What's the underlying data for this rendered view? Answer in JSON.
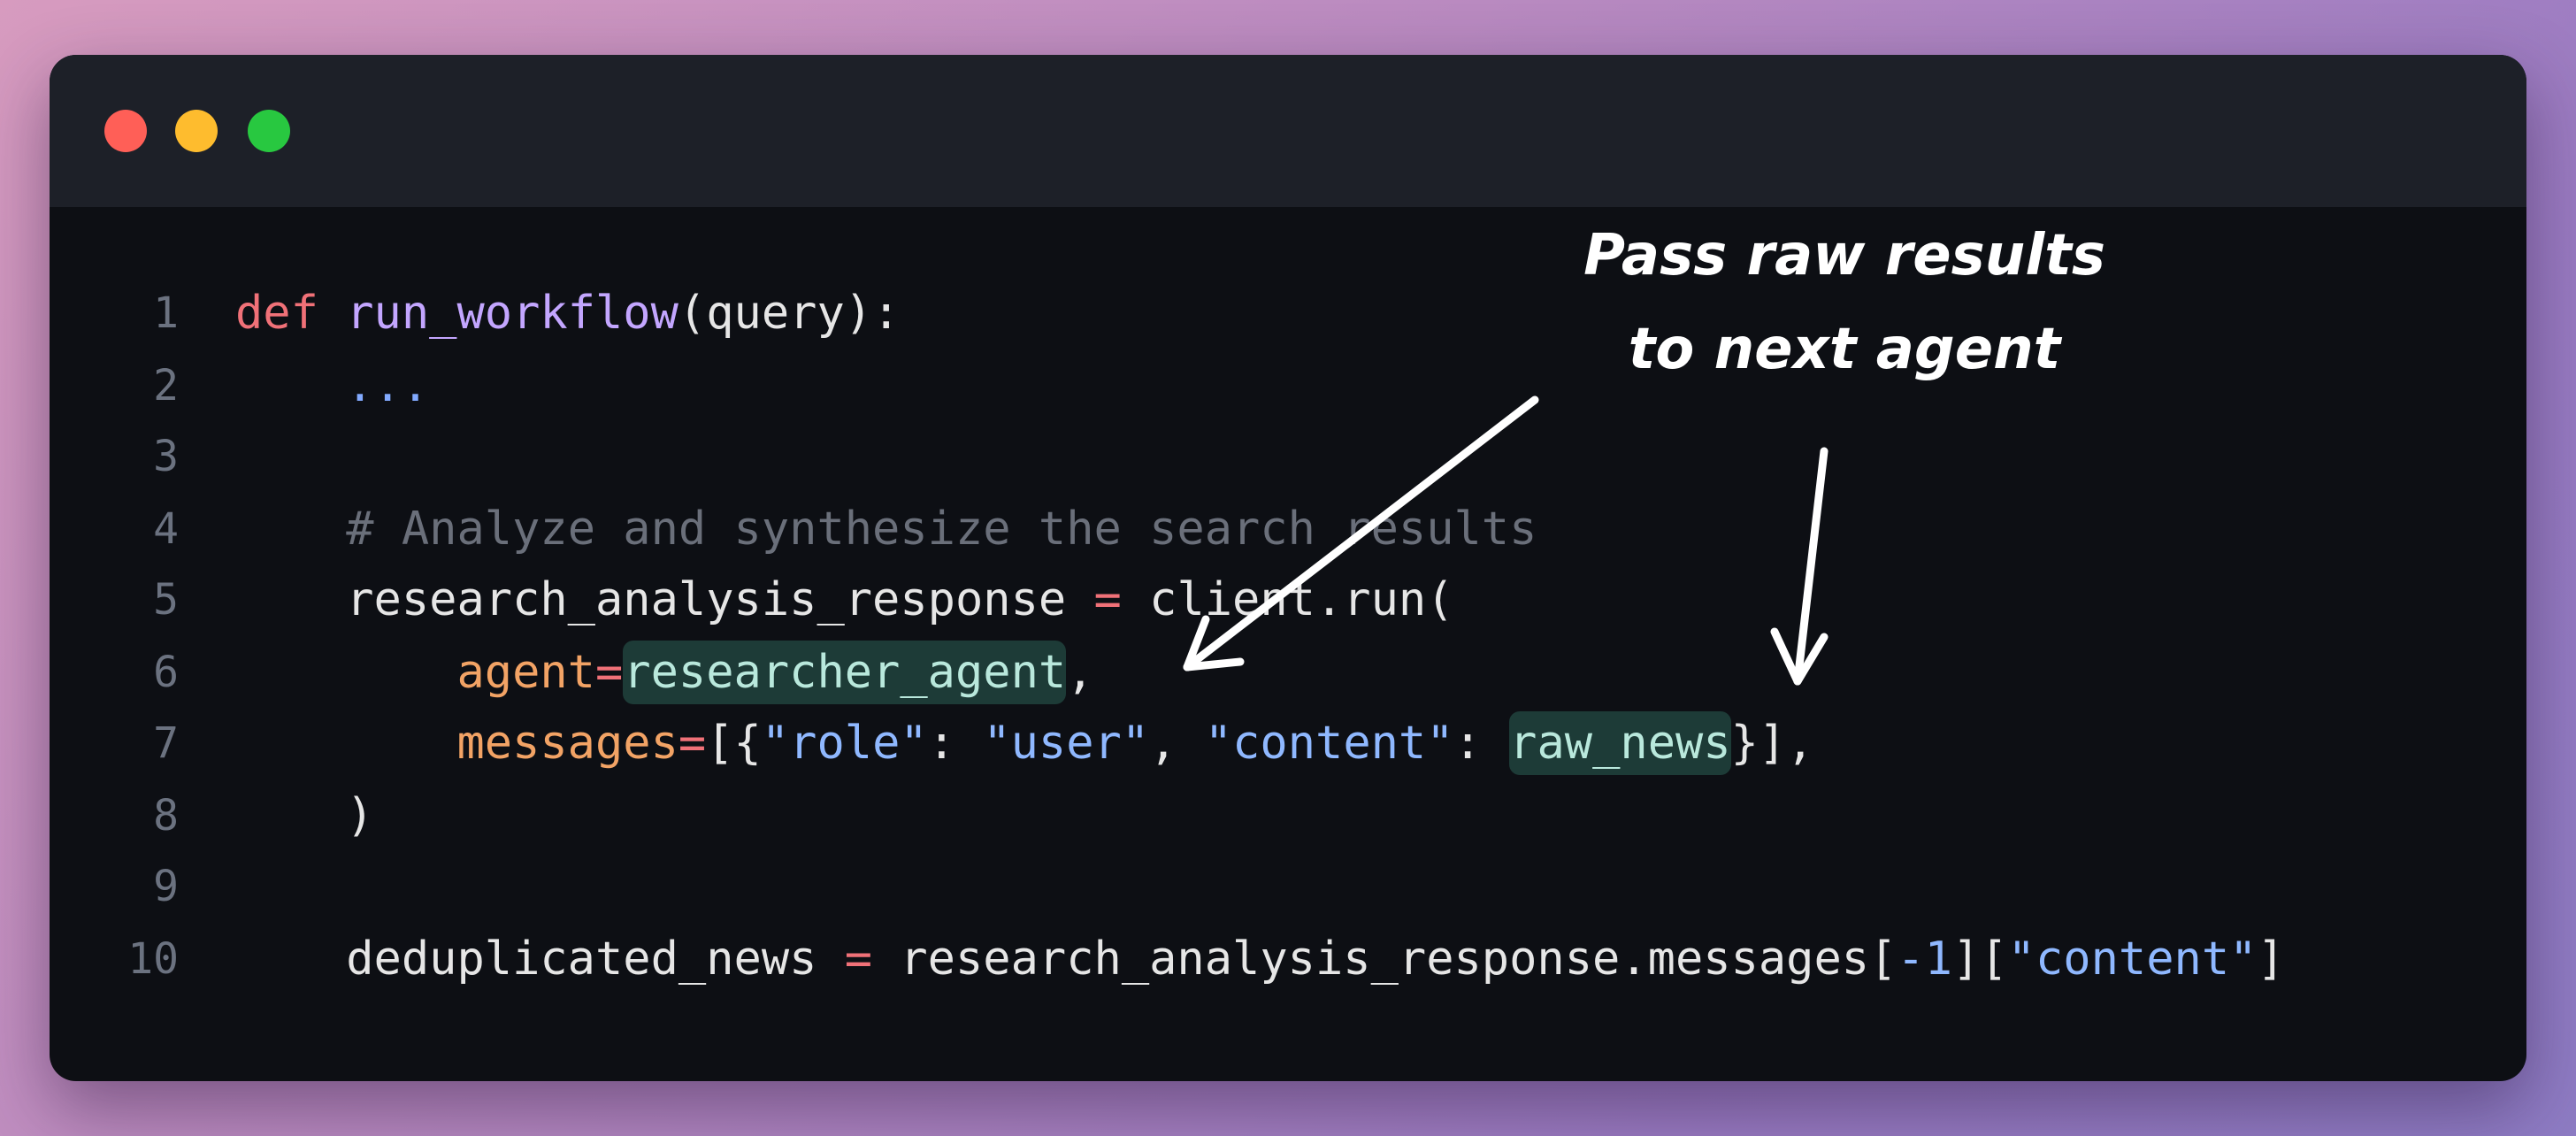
{
  "window": {
    "controls": {
      "close": "close",
      "minimize": "minimize",
      "maximize": "maximize"
    }
  },
  "code": {
    "lines": [
      {
        "n": "1",
        "segments": [
          {
            "t": "def",
            "c": "kw"
          },
          {
            "t": " ",
            "c": ""
          },
          {
            "t": "run_workflow",
            "c": "fn"
          },
          {
            "t": "(query):",
            "c": ""
          }
        ]
      },
      {
        "n": "2",
        "segments": [
          {
            "t": "    ",
            "c": ""
          },
          {
            "t": "...",
            "c": "dots"
          }
        ]
      },
      {
        "n": "3",
        "segments": []
      },
      {
        "n": "4",
        "segments": [
          {
            "t": "    ",
            "c": ""
          },
          {
            "t": "# Analyze and synthesize the search results",
            "c": "cm"
          }
        ]
      },
      {
        "n": "5",
        "segments": [
          {
            "t": "    research_analysis_response ",
            "c": ""
          },
          {
            "t": "=",
            "c": "op"
          },
          {
            "t": " client.run(",
            "c": ""
          }
        ]
      },
      {
        "n": "6",
        "segments": [
          {
            "t": "        ",
            "c": ""
          },
          {
            "t": "agent",
            "c": "param"
          },
          {
            "t": "=",
            "c": "op"
          },
          {
            "t": "researcher_agent",
            "c": "hl"
          },
          {
            "t": ",",
            "c": ""
          }
        ]
      },
      {
        "n": "7",
        "segments": [
          {
            "t": "        ",
            "c": ""
          },
          {
            "t": "messages",
            "c": "param"
          },
          {
            "t": "=",
            "c": "op"
          },
          {
            "t": "[{",
            "c": ""
          },
          {
            "t": "\"role\"",
            "c": "str"
          },
          {
            "t": ": ",
            "c": ""
          },
          {
            "t": "\"user\"",
            "c": "str"
          },
          {
            "t": ", ",
            "c": ""
          },
          {
            "t": "\"content\"",
            "c": "str"
          },
          {
            "t": ": ",
            "c": ""
          },
          {
            "t": "raw_news",
            "c": "hl"
          },
          {
            "t": "}],",
            "c": ""
          }
        ]
      },
      {
        "n": "8",
        "segments": [
          {
            "t": "    )",
            "c": ""
          }
        ]
      },
      {
        "n": "9",
        "segments": []
      },
      {
        "n": "10",
        "segments": [
          {
            "t": "    deduplicated_news ",
            "c": ""
          },
          {
            "t": "=",
            "c": "op"
          },
          {
            "t": " research_analysis_response.messages[",
            "c": ""
          },
          {
            "t": "-1",
            "c": "numv"
          },
          {
            "t": "][",
            "c": ""
          },
          {
            "t": "\"content\"",
            "c": "str"
          },
          {
            "t": "]",
            "c": ""
          }
        ]
      }
    ]
  },
  "annotation": {
    "line1": "Pass raw results",
    "line2": "to next agent"
  }
}
